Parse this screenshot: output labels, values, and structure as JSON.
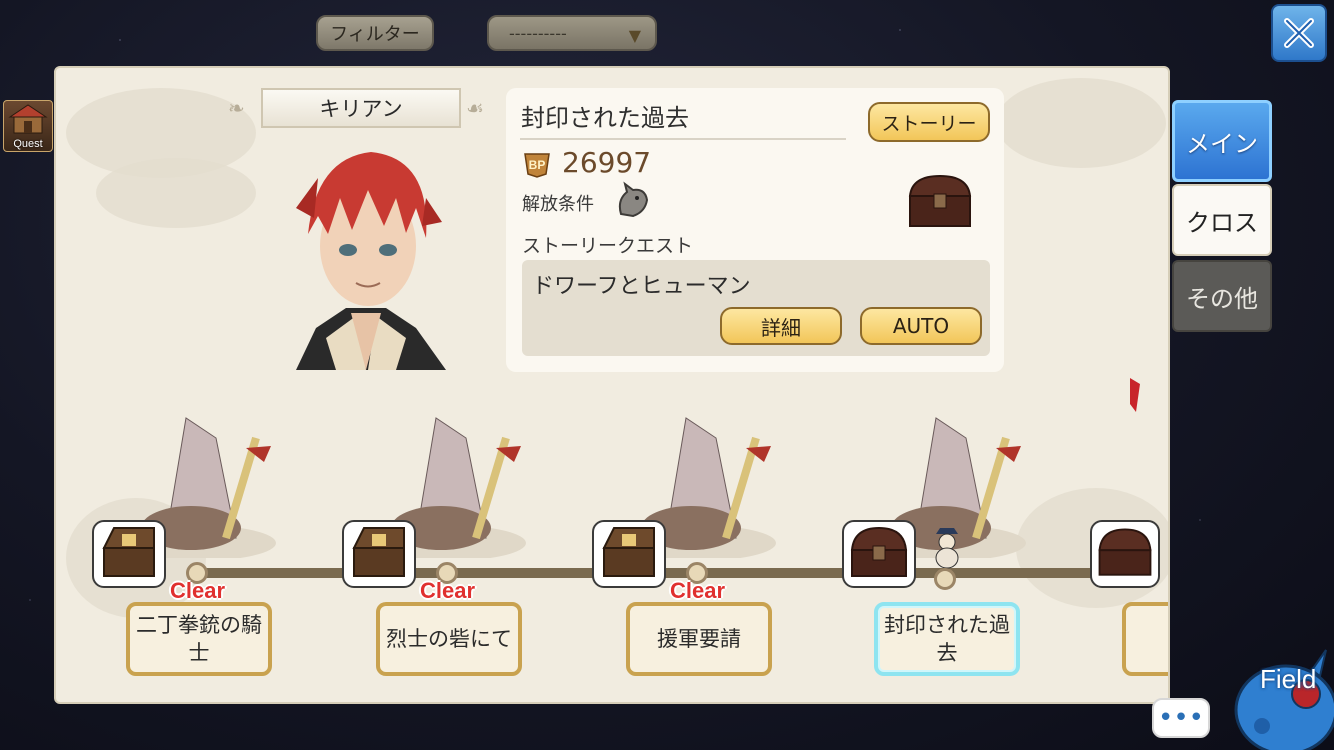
{
  "topbar": {
    "filter_label": "フィルター",
    "filter_value": "----------",
    "close_icon": "close-icon"
  },
  "hud": {
    "quest_label": "Quest"
  },
  "character": {
    "name": "キリアン"
  },
  "quest_info": {
    "title": "封印された過去",
    "story_button": "ストーリー",
    "bp_label": "BP",
    "bp_value": "26997",
    "unlock_label": "解放条件",
    "quest_type": "ストーリークエスト",
    "quest_name": "ドワーフとヒューマン",
    "detail_button": "詳細",
    "auto_button": "AUTO"
  },
  "stages": [
    {
      "label": "二丁拳銃の騎士",
      "cleared": true,
      "clear_text": "Clear"
    },
    {
      "label": "烈士の砦にて",
      "cleared": true,
      "clear_text": "Clear"
    },
    {
      "label": "援軍要請",
      "cleared": true,
      "clear_text": "Clear"
    },
    {
      "label": "封印された過去",
      "cleared": false,
      "active": true
    }
  ],
  "tabs": {
    "main": "メイン",
    "cross": "クロス",
    "other": "その他"
  },
  "chat": {
    "icon": "chat-ellipsis-icon"
  },
  "field": {
    "label": "Field"
  },
  "colors": {
    "accent_blue": "#2d73d2",
    "clear_red": "#e0302f",
    "button_gold": "#f2c659",
    "active_cyan": "#8ee4f0"
  }
}
